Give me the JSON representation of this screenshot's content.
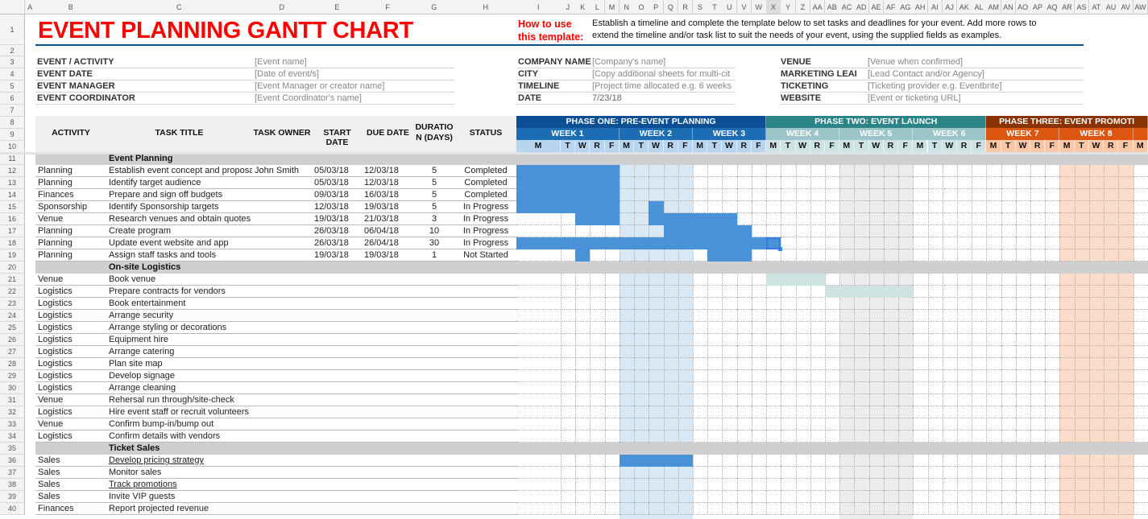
{
  "sheet": {
    "columns": [
      "A",
      "B",
      "C",
      "D",
      "E",
      "F",
      "G",
      "H",
      "I",
      "J",
      "K",
      "L",
      "M",
      "N",
      "O",
      "P",
      "Q",
      "R",
      "S",
      "T",
      "U",
      "V",
      "W",
      "X",
      "Y",
      "Z",
      "AA",
      "AB",
      "AC",
      "AD",
      "AE",
      "AF",
      "AG",
      "AH",
      "AI",
      "AJ",
      "AK",
      "AL",
      "AM",
      "AN",
      "AO",
      "AP",
      "AQ",
      "AR",
      "AS",
      "AT",
      "AU",
      "AV",
      "AW"
    ],
    "selected_column": "X",
    "rows": [
      "1",
      "2",
      "3",
      "4",
      "5",
      "6",
      "7",
      "8",
      "9",
      "10",
      "11",
      "12",
      "13",
      "14",
      "15",
      "16",
      "17",
      "18",
      "19",
      "20",
      "21",
      "22",
      "23",
      "24",
      "25",
      "26",
      "27",
      "28",
      "29",
      "30",
      "31",
      "32",
      "33",
      "34",
      "35",
      "36",
      "37",
      "38",
      "39",
      "40"
    ]
  },
  "title": "EVENT PLANNING GANTT CHART",
  "how_to": {
    "label_line1": "How to use",
    "label_line2": "this template:",
    "text_line1": "Establish a timeline and complete the template below to set tasks and deadlines for your event. Add more rows to",
    "text_line2": "extend the timeline and/or task list to suit the needs of your event, using the supplied fields as examples."
  },
  "info_left": [
    {
      "label": "EVENT / ACTIVITY",
      "value": "[Event name]"
    },
    {
      "label": "EVENT DATE",
      "value": "[Date of event/s]"
    },
    {
      "label": "EVENT MANAGER",
      "value": "[Event Manager or creator name]"
    },
    {
      "label": "EVENT COORDINATOR",
      "value": "[Event Coordinator's name]"
    }
  ],
  "info_mid": [
    {
      "label": "COMPANY NAME",
      "value": "[Company's name]"
    },
    {
      "label": "CITY",
      "value": "[Copy additional sheets for multi-cit"
    },
    {
      "label": "TIMELINE",
      "value": "[Project time allocated e.g. 6 weeks"
    },
    {
      "label": "DATE",
      "value": "7/23/18"
    }
  ],
  "info_right": [
    {
      "label": "VENUE",
      "value": "[Venue when confirmed]"
    },
    {
      "label": "MARKETING LEAI",
      "value": "[Lead Contact and/or Agency]"
    },
    {
      "label": "TICKETING",
      "value": "[Ticketing provider e.g. Eventbrite]"
    },
    {
      "label": "WEBSITE",
      "value": "[Event or ticketing URL]"
    }
  ],
  "table_headers": {
    "activity": "ACTIVITY",
    "task_title": "TASK TITLE",
    "task_owner": "TASK OWNER",
    "start_date": "START DATE",
    "due_date": "DUE DATE",
    "duration_l1": "DURATIO",
    "duration_l2": "N (DAYS)",
    "status": "STATUS"
  },
  "gantt": {
    "phases": [
      {
        "label": "PHASE ONE: PRE-EVENT PLANNING",
        "color": "#0c4f94",
        "weeks": [
          "WEEK 1",
          "WEEK 2",
          "WEEK 3"
        ],
        "week_color": "#1d6db5",
        "day_color": "#b7d5ee"
      },
      {
        "label": "PHASE TWO: EVENT LAUNCH",
        "color": "#2b8488",
        "weeks": [
          "WEEK 4",
          "WEEK 5",
          "WEEK 6"
        ],
        "week_color": "#9bc5c8",
        "day_color": "#cde2e3"
      },
      {
        "label": "PHASE THREE: EVENT PROMOTI",
        "color": "#8a3200",
        "weeks": [
          "WEEK 7",
          "WEEK 8",
          ""
        ],
        "week_color": "#dc5610",
        "day_color": "#fbc6a5"
      }
    ],
    "days": [
      "M",
      "T",
      "W",
      "R",
      "F"
    ],
    "bar_color": "#4a92d8",
    "teal_bar_color": "#cfe3e3",
    "shading": [
      {
        "week": 2,
        "color": "#d8e8f5"
      },
      {
        "week": 5,
        "color": "#ececec"
      },
      {
        "week": 8,
        "color": "#fcdccb"
      }
    ],
    "selected_day": 15
  },
  "sections": [
    {
      "title": "Event Planning",
      "tasks": [
        {
          "activity": "Planning",
          "title": "Establish event concept and proposal",
          "owner": "John Smith",
          "start": "05/03/18",
          "due": "12/03/18",
          "duration": "5",
          "status": "Completed",
          "days": [
            [
              0,
              4
            ]
          ]
        },
        {
          "activity": "Planning",
          "title": "Identify target audience",
          "owner": "",
          "start": "05/03/18",
          "due": "12/03/18",
          "duration": "5",
          "status": "Completed",
          "days": [
            [
              0,
              4
            ]
          ]
        },
        {
          "activity": "Finances",
          "title": "Prepare and sign off budgets",
          "owner": "",
          "start": "09/03/18",
          "due": "16/03/18",
          "duration": "5",
          "status": "Completed",
          "days": [
            [
              0,
              4
            ]
          ]
        },
        {
          "activity": "Sponsorship",
          "title": "Identify Sponsorship targets",
          "owner": "",
          "start": "12/03/18",
          "due": "19/03/18",
          "duration": "5",
          "status": "In Progress",
          "days": [
            [
              0,
              4
            ],
            [
              7,
              7
            ]
          ]
        },
        {
          "activity": "Venue",
          "title": "Research venues and obtain quotes",
          "owner": "",
          "start": "19/03/18",
          "due": "21/03/18",
          "duration": "3",
          "status": "In Progress",
          "days": [
            [
              2,
              4
            ],
            [
              7,
              12
            ]
          ]
        },
        {
          "activity": "Planning",
          "title": "Create program",
          "owner": "",
          "start": "26/03/18",
          "due": "06/04/18",
          "duration": "10",
          "status": "In Progress",
          "days": [
            [
              8,
              13
            ]
          ]
        },
        {
          "activity": "Planning",
          "title": "Update event website and app",
          "owner": "",
          "start": "26/03/18",
          "due": "26/04/18",
          "duration": "30",
          "status": "In Progress",
          "days": [
            [
              0,
              15
            ]
          ]
        },
        {
          "activity": "Planning",
          "title": "Assign staff tasks and tools",
          "owner": "",
          "start": "19/03/18",
          "due": "19/03/18",
          "duration": "1",
          "status": "Not Started",
          "days": [
            [
              2,
              2
            ],
            [
              11,
              13
            ]
          ]
        }
      ]
    },
    {
      "title": "On-site Logistics",
      "tasks": [
        {
          "activity": "Venue",
          "title": "Book venue",
          "teal_days": [
            [
              15,
              18
            ]
          ]
        },
        {
          "activity": "Logistics",
          "title": "Prepare contracts for vendors",
          "teal_days": [
            [
              19,
              24
            ]
          ]
        },
        {
          "activity": "Logistics",
          "title": "Book entertainment"
        },
        {
          "activity": "Logistics",
          "title": "Arrange security"
        },
        {
          "activity": "Logistics",
          "title": "Arrange styling or decorations"
        },
        {
          "activity": "Logistics",
          "title": "Equipment hire"
        },
        {
          "activity": "Logistics",
          "title": "Arrange catering"
        },
        {
          "activity": "Logistics",
          "title": "Plan site map"
        },
        {
          "activity": "Logistics",
          "title": "Develop signage"
        },
        {
          "activity": "Logistics",
          "title": "Arrange cleaning"
        },
        {
          "activity": "Venue",
          "title": "Rehersal run through/site-check"
        },
        {
          "activity": "Logistics",
          "title": "Hire event staff or recruit volunteers"
        },
        {
          "activity": "Venue",
          "title": "Confirm bump-in/bump out"
        },
        {
          "activity": "Logistics",
          "title": "Confirm details with vendors"
        }
      ]
    },
    {
      "title": "Ticket Sales",
      "tasks": [
        {
          "activity": "Sales",
          "title": "Develop pricing strategy",
          "link": true,
          "days": [
            [
              5,
              9
            ]
          ]
        },
        {
          "activity": "Sales",
          "title": "Monitor sales"
        },
        {
          "activity": "Sales",
          "title": "Track promotions",
          "link": true
        },
        {
          "activity": "Sales",
          "title": "Invite VIP guests"
        },
        {
          "activity": "Finances",
          "title": "Report projected revenue"
        }
      ]
    }
  ]
}
